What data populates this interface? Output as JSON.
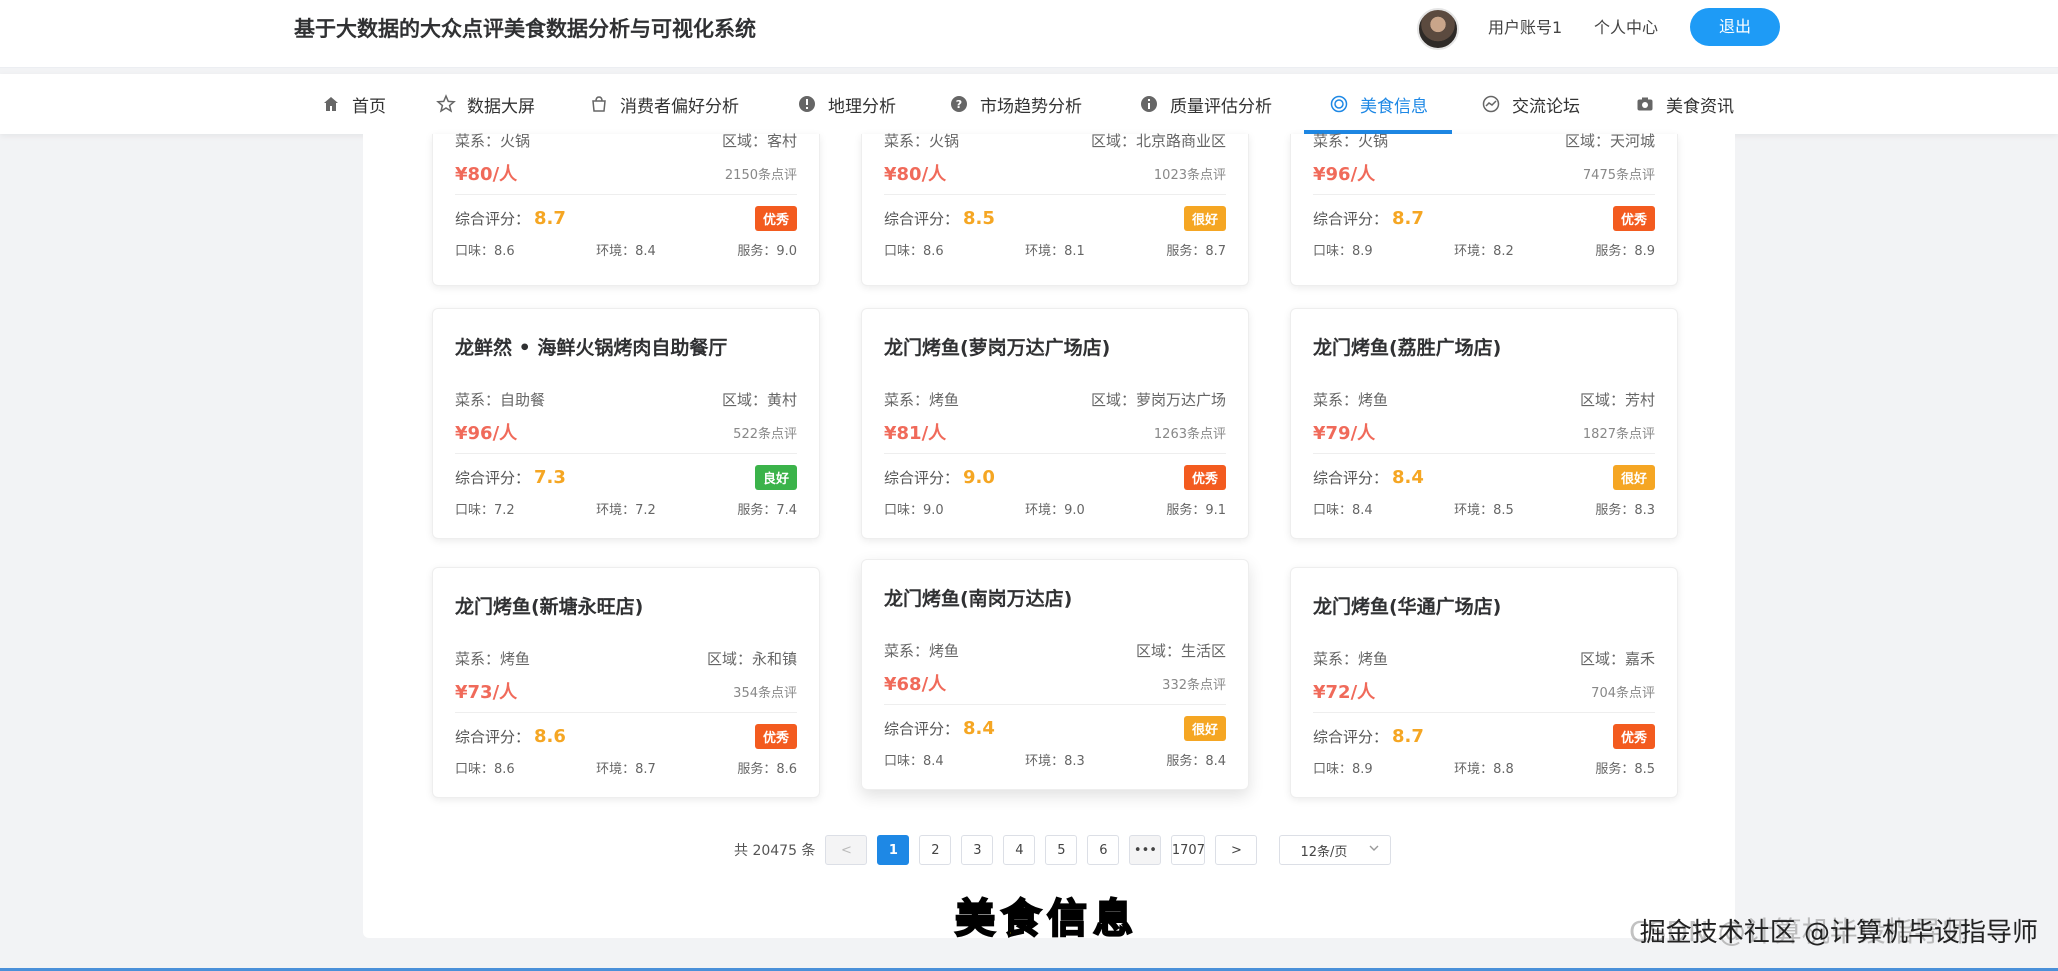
{
  "header": {
    "app_title": "基于大数据的大众点评美食数据分析与可视化系统",
    "user_name": "用户账号1",
    "profile_link": "个人中心",
    "logout_label": "退出"
  },
  "nav": {
    "items": [
      {
        "label": "首页",
        "icon": "home-icon"
      },
      {
        "label": "数据大屏",
        "icon": "star-icon"
      },
      {
        "label": "消费者偏好分析",
        "icon": "bag-icon"
      },
      {
        "label": "地理分析",
        "icon": "alert-icon"
      },
      {
        "label": "市场趋势分析",
        "icon": "help-icon"
      },
      {
        "label": "质量评估分析",
        "icon": "info-icon"
      },
      {
        "label": "美食信息",
        "icon": "target-icon",
        "active": true
      },
      {
        "label": "交流论坛",
        "icon": "chart-icon"
      },
      {
        "label": "美食资讯",
        "icon": "camera-icon"
      }
    ]
  },
  "cards": [
    {
      "name": "",
      "cuisine_label": "菜系：",
      "cuisine": "火锅",
      "region_label": "区域：",
      "region": "客村",
      "price": "¥80/人",
      "reviews": "2150条点评",
      "score_label": "综合评分：",
      "score": "8.7",
      "badge": "优秀",
      "badge_type": "excellent",
      "taste": "口味：8.6",
      "env": "环境：8.4",
      "service": "服务：9.0",
      "partial": true
    },
    {
      "name": "",
      "cuisine_label": "菜系：",
      "cuisine": "火锅",
      "region_label": "区域：",
      "region": "北京路商业区",
      "price": "¥80/人",
      "reviews": "1023条点评",
      "score_label": "综合评分：",
      "score": "8.5",
      "badge": "很好",
      "badge_type": "verygood",
      "taste": "口味：8.6",
      "env": "环境：8.1",
      "service": "服务：8.7",
      "partial": true
    },
    {
      "name": "",
      "cuisine_label": "菜系：",
      "cuisine": "火锅",
      "region_label": "区域：",
      "region": "天河城",
      "price": "¥96/人",
      "reviews": "7475条点评",
      "score_label": "综合评分：",
      "score": "8.7",
      "badge": "优秀",
      "badge_type": "excellent",
      "taste": "口味：8.9",
      "env": "环境：8.2",
      "service": "服务：8.9",
      "partial": true
    },
    {
      "name": "龙鲜然 • 海鲜火锅烤肉自助餐厅",
      "cuisine_label": "菜系：",
      "cuisine": "自助餐",
      "region_label": "区域：",
      "region": "黄村",
      "price": "¥96/人",
      "reviews": "522条点评",
      "score_label": "综合评分：",
      "score": "7.3",
      "badge": "良好",
      "badge_type": "good",
      "taste": "口味：7.2",
      "env": "环境：7.2",
      "service": "服务：7.4"
    },
    {
      "name": "龙门烤鱼(萝岗万达广场店)",
      "cuisine_label": "菜系：",
      "cuisine": "烤鱼",
      "region_label": "区域：",
      "region": "萝岗万达广场",
      "price": "¥81/人",
      "reviews": "1263条点评",
      "score_label": "综合评分：",
      "score": "9.0",
      "badge": "优秀",
      "badge_type": "excellent",
      "taste": "口味：9.0",
      "env": "环境：9.0",
      "service": "服务：9.1"
    },
    {
      "name": "龙门烤鱼(荔胜广场店)",
      "cuisine_label": "菜系：",
      "cuisine": "烤鱼",
      "region_label": "区域：",
      "region": "芳村",
      "price": "¥79/人",
      "reviews": "1827条点评",
      "score_label": "综合评分：",
      "score": "8.4",
      "badge": "很好",
      "badge_type": "verygood",
      "taste": "口味：8.4",
      "env": "环境：8.5",
      "service": "服务：8.3"
    },
    {
      "name": "龙门烤鱼(新塘永旺店)",
      "cuisine_label": "菜系：",
      "cuisine": "烤鱼",
      "region_label": "区域：",
      "region": "永和镇",
      "price": "¥73/人",
      "reviews": "354条点评",
      "score_label": "综合评分：",
      "score": "8.6",
      "badge": "优秀",
      "badge_type": "excellent",
      "taste": "口味：8.6",
      "env": "环境：8.7",
      "service": "服务：8.6"
    },
    {
      "name": "龙门烤鱼(南岗万达店)",
      "cuisine_label": "菜系：",
      "cuisine": "烤鱼",
      "region_label": "区域：",
      "region": "生活区",
      "price": "¥68/人",
      "reviews": "332条点评",
      "score_label": "综合评分：",
      "score": "8.4",
      "badge": "很好",
      "badge_type": "verygood",
      "taste": "口味：8.4",
      "env": "环境：8.3",
      "service": "服务：8.4"
    },
    {
      "name": "龙门烤鱼(华通广场店)",
      "cuisine_label": "菜系：",
      "cuisine": "烤鱼",
      "region_label": "区域：",
      "region": "嘉禾",
      "price": "¥72/人",
      "reviews": "704条点评",
      "score_label": "综合评分：",
      "score": "8.7",
      "badge": "优秀",
      "badge_type": "excellent",
      "taste": "口味：8.9",
      "env": "环境：8.8",
      "service": "服务：8.5"
    }
  ],
  "pagination": {
    "total": "共 20475 条",
    "prev": "<",
    "pages": [
      "1",
      "2",
      "3",
      "4",
      "5",
      "6"
    ],
    "current": "1",
    "ellipsis": "•••",
    "last": "1707",
    "next": ">",
    "page_size": "12条/页"
  },
  "caption": "美食信息",
  "watermark": {
    "ghost": "CSDN @计算机毕设指导师",
    "front": "掘金技术社区 @计算机毕设指导师"
  },
  "colors": {
    "primary": "#1e88e5",
    "price": "#f06a5a",
    "score": "#f5a623",
    "badge_excellent": "#f35b1f",
    "badge_verygood": "#f5a623",
    "badge_good": "#3bb34a"
  }
}
